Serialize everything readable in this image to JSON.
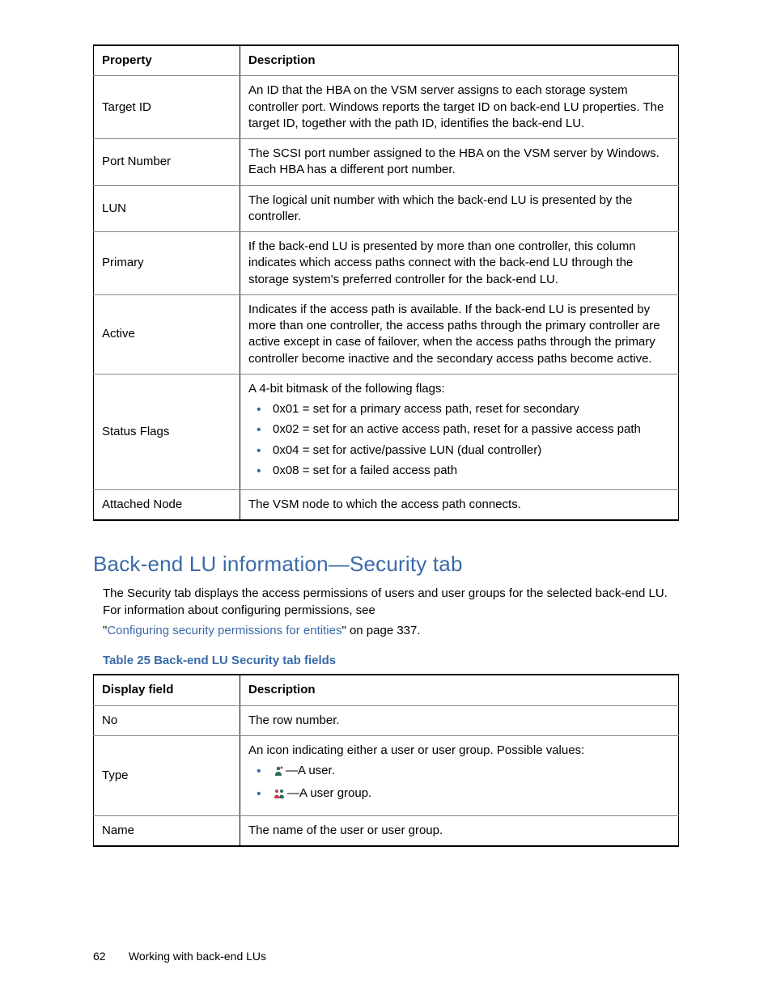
{
  "table1": {
    "headers": {
      "col1": "Property",
      "col2": "Description"
    },
    "rows": [
      {
        "prop": "Target ID",
        "desc": "An ID that the HBA on the VSM server assigns to each storage system controller port. Windows reports the target ID on back-end LU properties. The target ID, together with the path ID, identifies the back-end LU."
      },
      {
        "prop": "Port Number",
        "desc": "The SCSI port number assigned to the HBA on the VSM server by Windows. Each HBA has a different port number."
      },
      {
        "prop": "LUN",
        "desc": "The logical unit number with which the back-end LU is presented by the controller."
      },
      {
        "prop": "Primary",
        "desc": "If the back-end LU is presented by more than one controller, this column indicates which access paths connect with the back-end LU through the storage system's preferred controller for the back-end LU."
      },
      {
        "prop": "Active",
        "desc": "Indicates if the access path is available. If the back-end LU is presented by more than one controller, the access paths through the primary controller are active except in case of failover, when the access paths through the primary controller become inactive and the secondary access paths become active."
      },
      {
        "prop": "Status Flags",
        "desc_intro": "A 4-bit bitmask of the following flags:",
        "flags": [
          "0x01 = set for a primary access path, reset for secondary",
          "0x02 = set for an active access path, reset for a passive access path",
          "0x04 = set for active/passive LUN (dual controller)",
          "0x08 = set for a failed access path"
        ]
      },
      {
        "prop": "Attached Node",
        "desc": "The VSM node to which the access path connects."
      }
    ]
  },
  "section_heading": "Back-end LU information—Security tab",
  "body1": "The Security tab displays the access permissions of users and user groups for the selected back-end LU. For information about configuring permissions, see",
  "link_text": "Configuring security permissions for entities",
  "link_suffix": "\" on page 337.",
  "link_prefix": "\"",
  "table_caption": "Table 25 Back-end LU Security tab fields",
  "table2": {
    "headers": {
      "col1": "Display field",
      "col2": "Description"
    },
    "rows": [
      {
        "field": "No",
        "desc": "The row number."
      },
      {
        "field": "Type",
        "desc_intro": "An icon indicating either a user or user group. Possible values:",
        "items": [
          {
            "icon": "user",
            "text": "—A user."
          },
          {
            "icon": "group",
            "text": "—A user group."
          }
        ]
      },
      {
        "field": "Name",
        "desc": "The name of the user or user group."
      }
    ]
  },
  "footer": {
    "page": "62",
    "title": "Working with back-end LUs"
  }
}
